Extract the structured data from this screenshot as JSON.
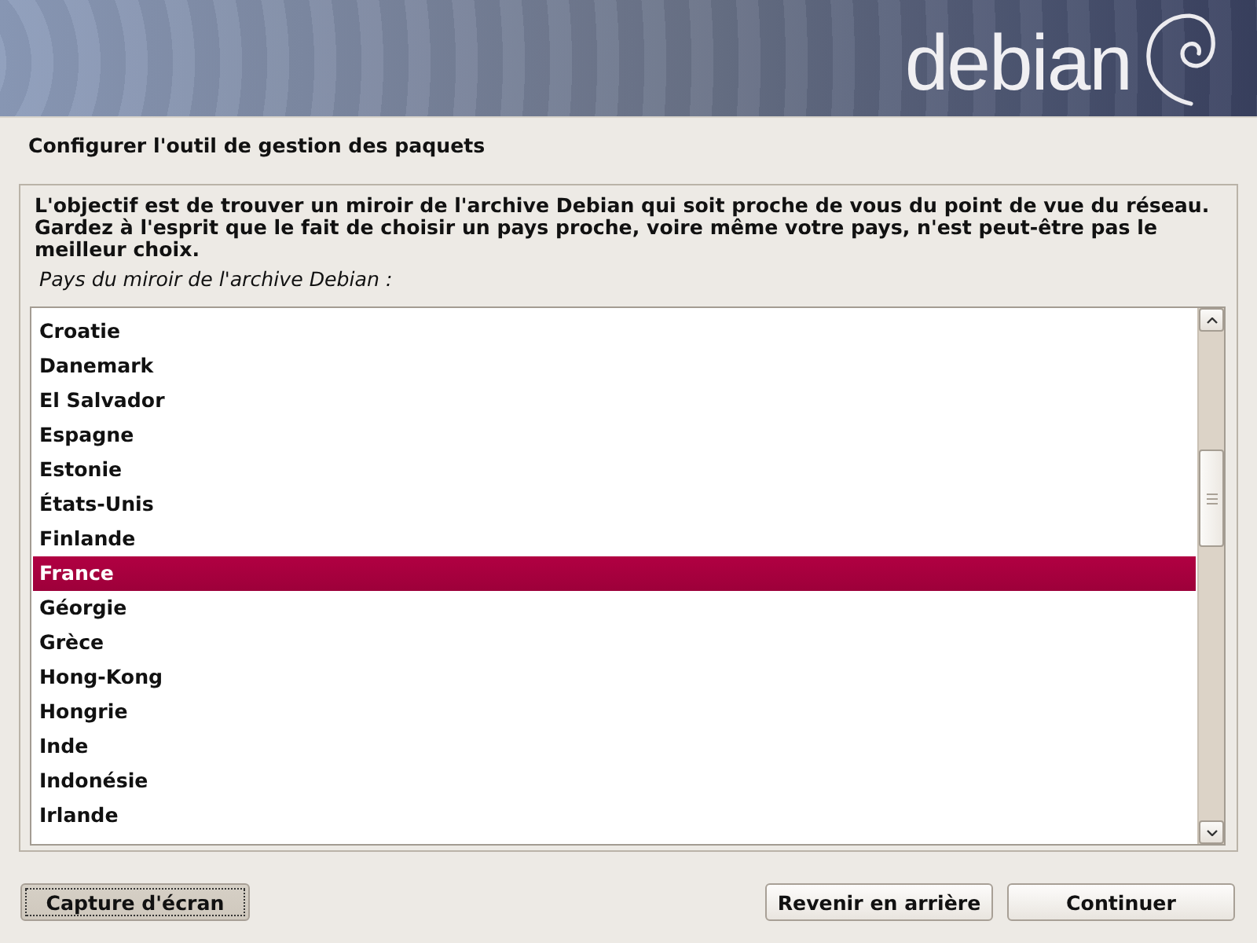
{
  "banner": {
    "logo_text": "debian"
  },
  "title": "Configurer l'outil de gestion des paquets",
  "description": "L'objectif est de trouver un miroir de l'archive Debian qui soit proche de vous du point de vue du réseau. Gardez à l'esprit que le fait de choisir un pays proche, voire même votre pays, n'est peut-être pas le meilleur choix.",
  "list_label": "Pays du miroir de l'archive Debian :",
  "countries": [
    {
      "name": "Croatie",
      "selected": false
    },
    {
      "name": "Danemark",
      "selected": false
    },
    {
      "name": "El Salvador",
      "selected": false
    },
    {
      "name": "Espagne",
      "selected": false
    },
    {
      "name": "Estonie",
      "selected": false
    },
    {
      "name": "États-Unis",
      "selected": false
    },
    {
      "name": "Finlande",
      "selected": false
    },
    {
      "name": "France",
      "selected": true
    },
    {
      "name": "Géorgie",
      "selected": false
    },
    {
      "name": "Grèce",
      "selected": false
    },
    {
      "name": "Hong-Kong",
      "selected": false
    },
    {
      "name": "Hongrie",
      "selected": false
    },
    {
      "name": "Inde",
      "selected": false
    },
    {
      "name": "Indonésie",
      "selected": false
    },
    {
      "name": "Irlande",
      "selected": false
    }
  ],
  "screenshot_button": {
    "label": "Capture d'écran",
    "focused": true
  },
  "nav_buttons": [
    {
      "label": "Revenir en arrière",
      "focused": false
    },
    {
      "label": "Continuer",
      "focused": false
    }
  ]
}
